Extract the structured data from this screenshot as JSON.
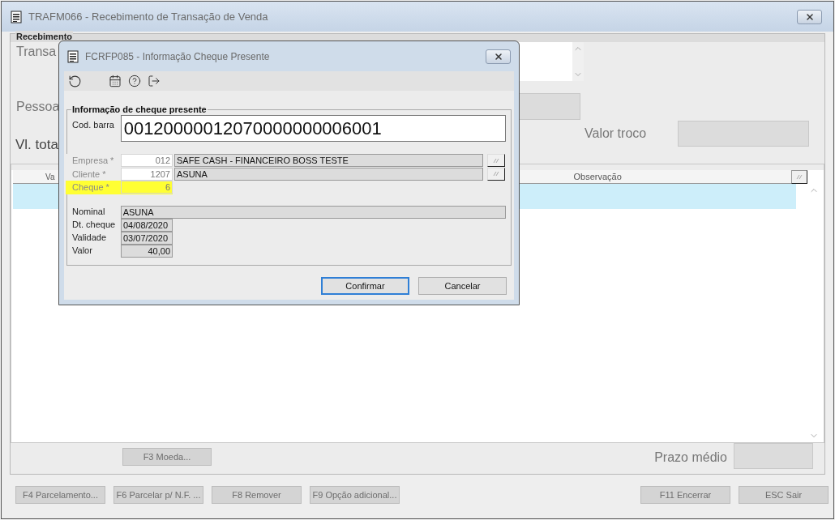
{
  "main_window": {
    "title": "TRAFM066 - Recebimento de Transação de Venda",
    "group_title": "Recebimento",
    "labels": {
      "transacao": "Transa",
      "pessoa": "Pessoa",
      "total": "Vl. tota",
      "valor_troco": "Valor troco",
      "prazo_medio": "Prazo médio"
    },
    "table": {
      "columns": [
        "Va",
        "Observação"
      ],
      "rows": [
        {
          "selected": true
        }
      ]
    },
    "moeda_button": "F3 Moeda...",
    "footer_left": [
      "F4 Parcelamento...",
      "F6 Parcelar p/ N.F. ...",
      "F8 Remover",
      "F9 Opção adicional..."
    ],
    "footer_right": [
      "F11 Encerrar",
      "ESC Sair"
    ]
  },
  "dialog": {
    "title": "FCRFP085 - Informação Cheque Presente",
    "group_title": "Informação de cheque presente",
    "barcode": {
      "label": "Cod. barra",
      "value": "00120000012070000000006001"
    },
    "key_fields": [
      {
        "label": "Empresa *",
        "code": "012",
        "name": "SAFE CASH - FINANCEIRO BOSS TESTE",
        "highlighted": false
      },
      {
        "label": "Cliente *",
        "code": "1207",
        "name": "ASUNA",
        "highlighted": false
      },
      {
        "label": "Cheque *",
        "code": "6",
        "highlighted": true
      }
    ],
    "details": [
      {
        "label": "Nominal",
        "value": "ASUNA",
        "kind": "wide"
      },
      {
        "label": "Dt. cheque",
        "value": "04/08/2020",
        "kind": "date"
      },
      {
        "label": "Validade",
        "value": "03/07/2020",
        "kind": "date"
      },
      {
        "label": "Valor",
        "value": "40,00",
        "kind": "amount"
      }
    ],
    "buttons": [
      {
        "label": "Confirmar",
        "focused": true
      },
      {
        "label": "Cancelar",
        "focused": false
      }
    ]
  }
}
